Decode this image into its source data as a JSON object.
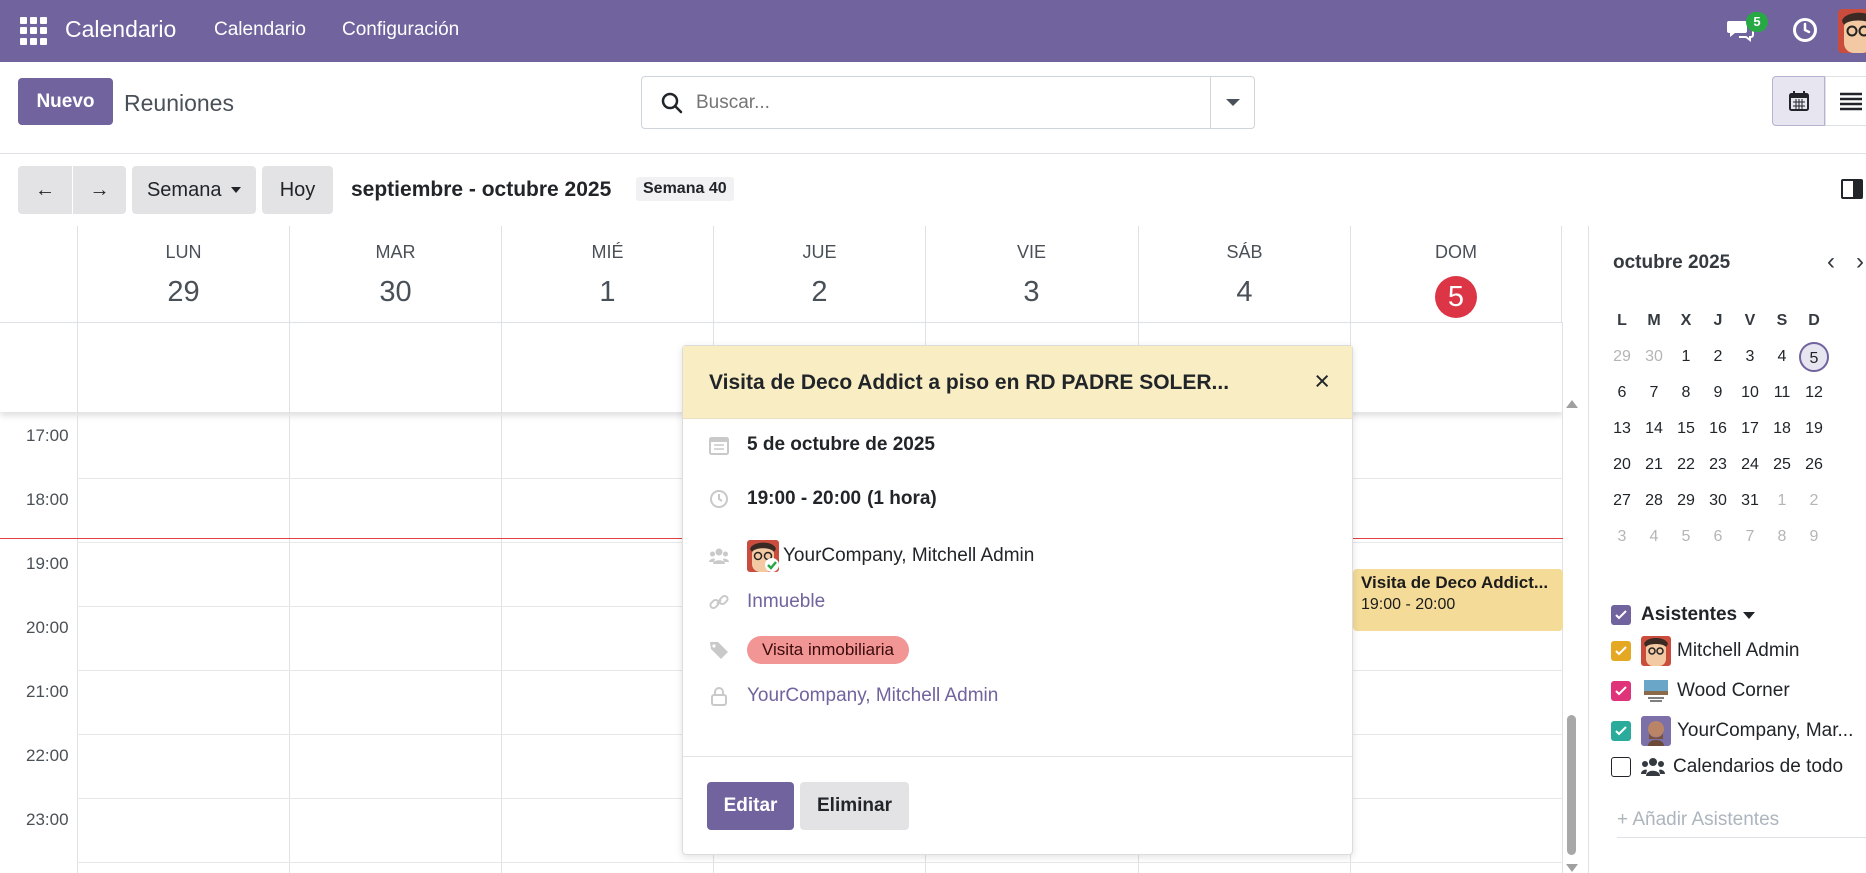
{
  "app": {
    "brand": "Calendario",
    "menu": [
      "Calendario",
      "Configuración"
    ],
    "chat_count": "5"
  },
  "control": {
    "new_label": "Nuevo",
    "breadcrumb": "Reuniones",
    "search_placeholder": "Buscar..."
  },
  "nav": {
    "scale_label": "Semana",
    "today_label": "Hoy",
    "period_title": "septiembre - octubre 2025",
    "week_badge": "Semana 40"
  },
  "days": [
    {
      "name": "LUN",
      "num": "29"
    },
    {
      "name": "MAR",
      "num": "30"
    },
    {
      "name": "MIÉ",
      "num": "1"
    },
    {
      "name": "JUE",
      "num": "2"
    },
    {
      "name": "VIE",
      "num": "3"
    },
    {
      "name": "SÁB",
      "num": "4"
    },
    {
      "name": "DOM",
      "num": "5"
    }
  ],
  "hours": [
    "17:00",
    "18:00",
    "19:00",
    "20:00",
    "21:00",
    "22:00",
    "23:00"
  ],
  "event_chip": {
    "title": "Visita de Deco Addict...",
    "time": "19:00 - 20:00"
  },
  "popover": {
    "title": "Visita de Deco Addict a piso en RD PADRE SOLER...",
    "date": "5 de octubre de 2025",
    "time": "19:00 - 20:00",
    "duration": "(1 hora)",
    "attendees": "YourCompany, Mitchell Admin",
    "resource_link": "Inmueble",
    "tag": "Visita inmobiliaria",
    "organizer": "YourCompany, Mitchell Admin",
    "edit_label": "Editar",
    "delete_label": "Eliminar"
  },
  "mini_calendar": {
    "title": "octubre 2025",
    "weekdays": [
      "L",
      "M",
      "X",
      "J",
      "V",
      "S",
      "D"
    ],
    "weeks": [
      [
        "29",
        "30",
        "1",
        "2",
        "3",
        "4",
        "5"
      ],
      [
        "6",
        "7",
        "8",
        "9",
        "10",
        "11",
        "12"
      ],
      [
        "13",
        "14",
        "15",
        "16",
        "17",
        "18",
        "19"
      ],
      [
        "20",
        "21",
        "22",
        "23",
        "24",
        "25",
        "26"
      ],
      [
        "27",
        "28",
        "29",
        "30",
        "31",
        "1",
        "2"
      ],
      [
        "3",
        "4",
        "5",
        "6",
        "7",
        "8",
        "9"
      ]
    ]
  },
  "attendees_panel": {
    "header": "Asistentes",
    "items": [
      {
        "name": "Mitchell Admin",
        "color": "#e5a823"
      },
      {
        "name": "Wood Corner",
        "color": "#e0347a"
      },
      {
        "name": "YourCompany, Mar...",
        "color": "#2bab9b"
      },
      {
        "name": "Calendarios de todo",
        "color": "#ffffff"
      }
    ],
    "add_placeholder": "+ Añadir Asistentes"
  },
  "colors": {
    "brand": "#71639e",
    "today": "#dc3545",
    "event": "#f4dc98",
    "tag": "#f29595"
  }
}
